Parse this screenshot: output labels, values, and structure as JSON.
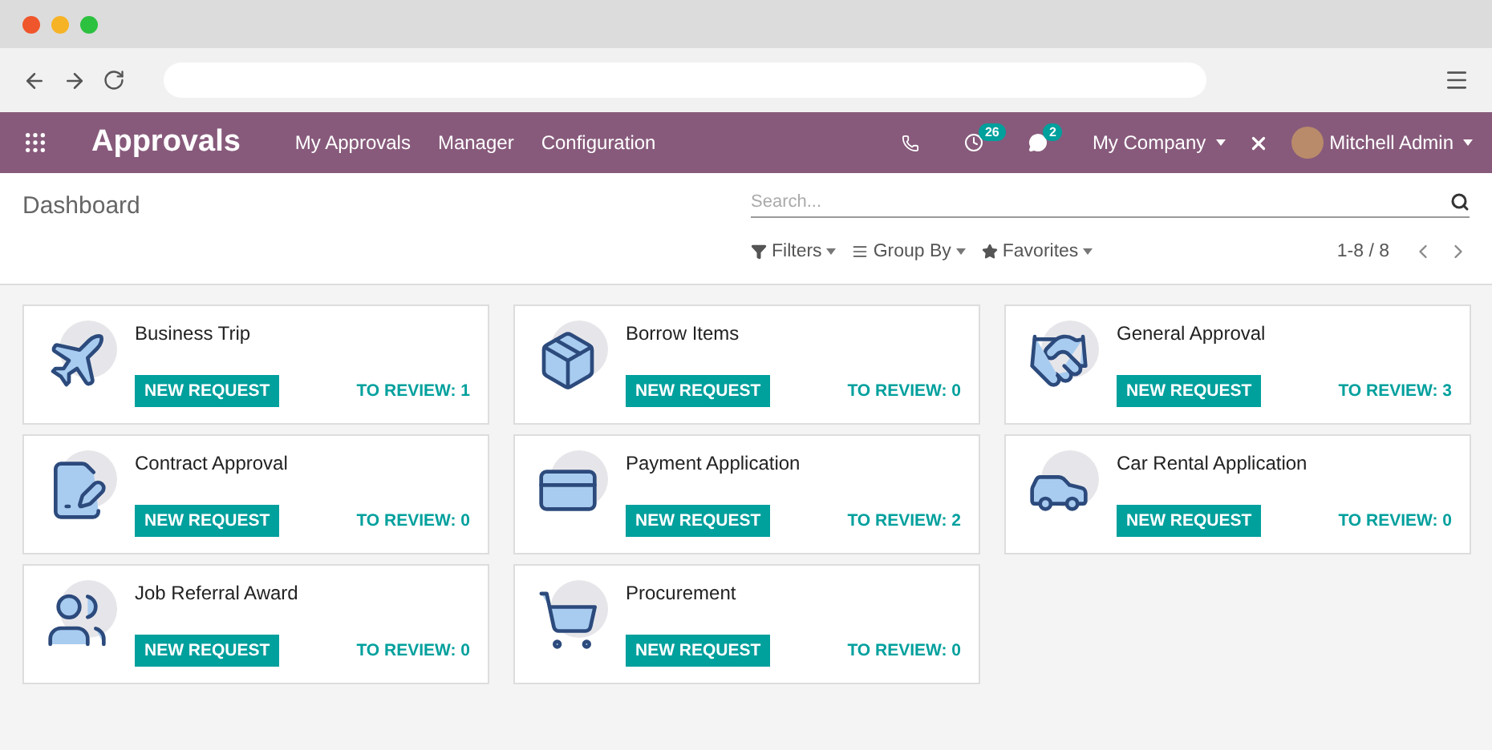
{
  "navbar": {
    "app_name": "Approvals",
    "menu": [
      "My Approvals",
      "Manager",
      "Configuration"
    ],
    "activity_count": "26",
    "message_count": "2",
    "company": "My Company",
    "user": "Mitchell Admin"
  },
  "control_panel": {
    "breadcrumb": "Dashboard",
    "search": {
      "placeholder": "Search..."
    },
    "filters": [
      "Filters",
      "Group By",
      "Favorites"
    ],
    "pager": "1-8 / 8"
  },
  "cards": [
    {
      "kind": "plane",
      "title": "Business Trip",
      "button": "NEW REQUEST",
      "review": "TO REVIEW: 1"
    },
    {
      "kind": "box",
      "title": "Borrow Items",
      "button": "NEW REQUEST",
      "review": "TO REVIEW: 0"
    },
    {
      "kind": "handshake",
      "title": "General Approval",
      "button": "NEW REQUEST",
      "review": "TO REVIEW: 3"
    },
    {
      "kind": "contract",
      "title": "Contract Approval",
      "button": "NEW REQUEST",
      "review": "TO REVIEW: 0"
    },
    {
      "kind": "card",
      "title": "Payment Application",
      "button": "NEW REQUEST",
      "review": "TO REVIEW: 2"
    },
    {
      "kind": "car",
      "title": "Car Rental Application",
      "button": "NEW REQUEST",
      "review": "TO REVIEW: 0"
    },
    {
      "kind": "people",
      "title": "Job Referral Award",
      "button": "NEW REQUEST",
      "review": "TO REVIEW: 0"
    },
    {
      "kind": "cart",
      "title": "Procurement",
      "button": "NEW REQUEST",
      "review": "TO REVIEW: 0"
    }
  ]
}
